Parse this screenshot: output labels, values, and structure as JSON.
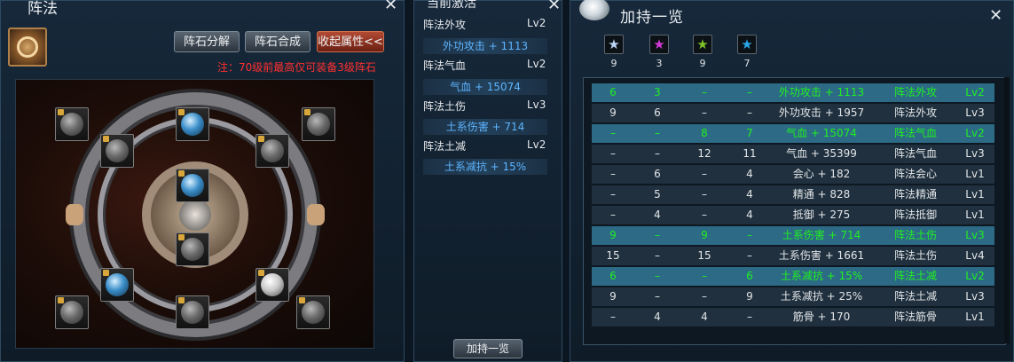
{
  "formation": {
    "title": "阵法",
    "close": "✕",
    "buttons": {
      "decompose": "阵石分解",
      "combine": "阵石合成",
      "collapse": "收起属性<<"
    },
    "note": "注：70级前最高仅可装备3级阵石"
  },
  "active": {
    "title": "当前激活",
    "close": "✕",
    "items": [
      {
        "name": "阵法外攻",
        "level": "Lv2",
        "value": "外功攻击 + 1113"
      },
      {
        "name": "阵法气血",
        "level": "Lv2",
        "value": "气血 + 15074"
      },
      {
        "name": "阵法土伤",
        "level": "Lv3",
        "value": "土系伤害 + 714"
      },
      {
        "name": "阵法土减",
        "level": "Lv2",
        "value": "土系减抗 + 15%"
      }
    ],
    "bottom_button": "加持一览"
  },
  "bonus": {
    "title": "加持一览",
    "close": "✕",
    "star_counts": [
      "9",
      "3",
      "9",
      "7"
    ],
    "star_colors": [
      "#bcd6f5",
      "#d23ad8",
      "#7ec228",
      "#2aa6ea"
    ],
    "rows": [
      {
        "c": [
          "6",
          "3",
          "–",
          "–",
          "外功攻击 + 1113",
          "阵法外攻",
          "Lv2"
        ],
        "active": true
      },
      {
        "c": [
          "9",
          "6",
          "–",
          "–",
          "外功攻击 + 1957",
          "阵法外攻",
          "Lv3"
        ],
        "active": false
      },
      {
        "c": [
          "–",
          "–",
          "8",
          "7",
          "气血 + 15074",
          "阵法气血",
          "Lv2"
        ],
        "active": true
      },
      {
        "c": [
          "–",
          "–",
          "12",
          "11",
          "气血 + 35399",
          "阵法气血",
          "Lv3"
        ],
        "active": false
      },
      {
        "c": [
          "–",
          "6",
          "–",
          "4",
          "会心 + 182",
          "阵法会心",
          "Lv1"
        ],
        "active": false
      },
      {
        "c": [
          "–",
          "5",
          "–",
          "4",
          "精通 + 828",
          "阵法精通",
          "Lv1"
        ],
        "active": false
      },
      {
        "c": [
          "–",
          "4",
          "–",
          "4",
          "抵御 + 275",
          "阵法抵御",
          "Lv1"
        ],
        "active": false
      },
      {
        "c": [
          "9",
          "–",
          "9",
          "–",
          "土系伤害 + 714",
          "阵法土伤",
          "Lv3"
        ],
        "active": true
      },
      {
        "c": [
          "15",
          "–",
          "15",
          "–",
          "土系伤害 + 1661",
          "阵法土伤",
          "Lv4"
        ],
        "active": false
      },
      {
        "c": [
          "6",
          "–",
          "–",
          "6",
          "土系减抗 + 15%",
          "阵法土减",
          "Lv2"
        ],
        "active": true
      },
      {
        "c": [
          "9",
          "–",
          "–",
          "9",
          "土系减抗 + 25%",
          "阵法土减",
          "Lv3"
        ],
        "active": false
      },
      {
        "c": [
          "–",
          "4",
          "4",
          "–",
          "筋骨 + 170",
          "阵法筋骨",
          "Lv1"
        ],
        "active": false
      }
    ]
  }
}
